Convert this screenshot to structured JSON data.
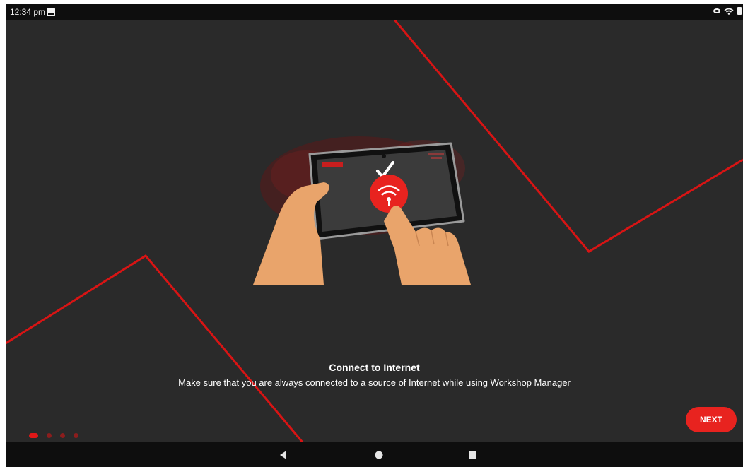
{
  "status_bar": {
    "time": "12:34 pm",
    "icons": [
      "notification-icon",
      "eye-icon",
      "wifi-icon",
      "battery-icon"
    ]
  },
  "onboarding": {
    "title": "Connect to Internet",
    "description": "Make sure that you are always connected to a source of Internet while using Workshop Manager",
    "illustration_icon": "tablet-wifi-illustration",
    "page_indicator": {
      "total": 4,
      "current": 1
    }
  },
  "actions": {
    "next_label": "NEXT"
  },
  "nav_bar": {
    "icons": [
      "back-icon",
      "home-icon",
      "recents-icon"
    ]
  },
  "colors": {
    "background": "#2a2a2a",
    "accent": "#e8231f",
    "bars": "#0e0e0e",
    "text": "#ffffff"
  }
}
